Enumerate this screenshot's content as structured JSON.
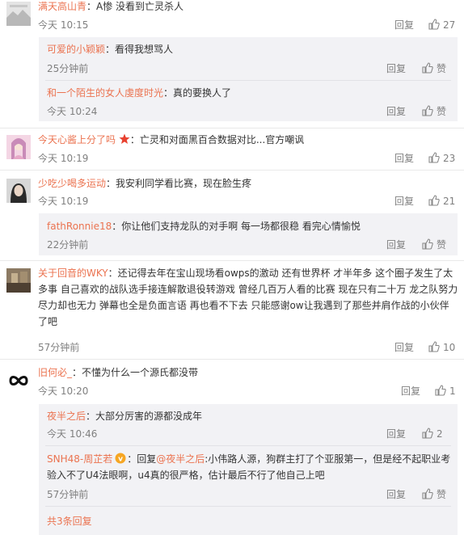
{
  "colors": {
    "username": "#eb7350",
    "meta": "#808080",
    "reply_bg": "#f2f2f5"
  },
  "reply_label": "回复",
  "like_label": "赞",
  "comments": [
    {
      "user": "满天高山青",
      "text": "：A惨 没看到亡灵杀人",
      "time": "今天 10:15",
      "likes": "27"
    },
    {
      "user": "今天心酱上分了吗",
      "text": "：亡灵和对面黑百合数据对比...官方嘲讽",
      "time": "今天 10:19",
      "likes": "23"
    },
    {
      "user": "少吃少喝多运动",
      "text": "：我安利同学看比赛，现在脸生疼",
      "time": "今天 10:19",
      "likes": "21"
    },
    {
      "user": "关于回音的WKY",
      "text": "：还记得去年在宝山现场看owps的激动 还有世界杯 才半年多 这个圈子发生了太多事 自己喜欢的战队选手接连解散退役转游戏 曾经几百万人看的比赛 现在只有二十万 龙之队努力尽力却也无力 弹幕也全是负面言语 再也看不下去 只能感谢ow让我遇到了那些并肩作战的小伙伴了吧",
      "time": "57分钟前",
      "likes": "10"
    },
    {
      "user": "旧何必_",
      "text": "：不懂为什么一个源氏都没带",
      "time": "今天 10:20",
      "likes": "1"
    }
  ],
  "replies": [
    {
      "user": "可爱的小颖颖",
      "text": "：看得我想骂人",
      "time": "25分钟前",
      "likes": ""
    },
    {
      "user": "和一个陌生的女人虔度时光",
      "text": "：真的要换人了",
      "time": "今天 10:24",
      "likes": ""
    },
    {
      "user": "fathRonnie18",
      "text": "：你让他们支持龙队的对手啊 每一场都很稳 看完心情愉悦",
      "time": "22分钟前",
      "likes": ""
    },
    {
      "user": "夜半之后",
      "text": "：大部分厉害的源都没成年",
      "time": "今天 10:46",
      "likes": "2"
    },
    {
      "user": "SNH48-周芷若",
      "reply_prefix": "：回复",
      "mention": "@夜半之后",
      "text": ":小伟路人源，狗群主打了个亚服第一，但是经不起职业考验入不了U4法眼啊，u4真的很严格，估计最后不行了他自己上吧",
      "time": "57分钟前",
      "likes": ""
    }
  ],
  "more_replies": "共3条回复"
}
